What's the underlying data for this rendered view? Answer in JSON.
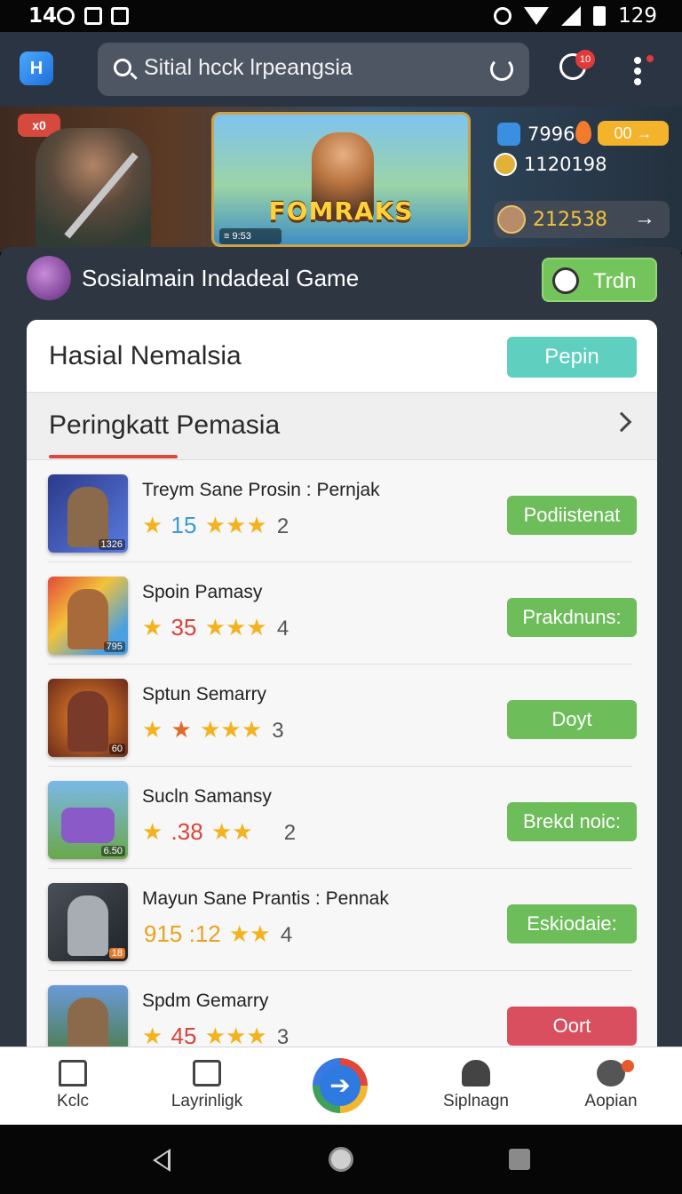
{
  "status_bar": {
    "time": "14",
    "battery_text": "129",
    "icons": [
      "message-icon",
      "notification-icon",
      "photo-icon",
      "alarm-icon",
      "wifi-icon",
      "signal-icon",
      "battery-icon"
    ]
  },
  "app_bar": {
    "logo_text": "H",
    "search_value": "Sitial hcck lrpeangsia",
    "chat_badge": "10"
  },
  "banner": {
    "badge": "x0",
    "game_title": "FOMRAKS",
    "game_subtitle": "★★★",
    "mini_label": "≡ 9:53",
    "coins": "79969",
    "coins_pill": "00 →",
    "gems": "1120198",
    "xp": "212538",
    "xp_arrow": "→"
  },
  "section": {
    "title": "Sosialmain Indadeal Game",
    "trdn_label": "Trdn"
  },
  "panel": {
    "title": "Hasial Nemalsia",
    "pepin_label": "Pepin",
    "rank_title": "Peringkatt Pemasia"
  },
  "items": [
    {
      "name": "Treym Sane Prosin : Pernjak",
      "stars_left": "★",
      "rating": "15",
      "stars_right": "★★★",
      "count": "2",
      "tag": "1326",
      "button": "Podiistenat",
      "rating_color": "#3a9bd6",
      "button_color": "green"
    },
    {
      "name": "Spoin Pamasy",
      "stars_left": "★",
      "rating": "35",
      "stars_right": "★★★",
      "count": "4",
      "tag": "795",
      "button": "Prakdnuns:",
      "rating_color": "#d8453a",
      "button_color": "green"
    },
    {
      "name": "Sptun Semarry",
      "stars_left": "★",
      "rating": "★",
      "stars_right": "★★★",
      "count": "3",
      "tag": "60",
      "button": "Doyt",
      "rating_color": "#e06a2a",
      "button_color": "green"
    },
    {
      "name": "Sucln Samansy",
      "stars_left": "★",
      "rating": ".38",
      "stars_right": "★★",
      "count": "2",
      "tag": "6.50",
      "button": "Brekd noic:",
      "rating_color": "#d8453a",
      "button_color": "green"
    },
    {
      "name": "Mayun Sane Prantis : Pennak",
      "stars_left": "",
      "rating": "915 :12",
      "stars_right": "★★",
      "count": "4",
      "tag": "18",
      "button": "Eskiodaie:",
      "rating_color": "#e8a21e",
      "button_color": "green"
    },
    {
      "name": "Spdm Gemarry",
      "stars_left": "★",
      "rating": "45",
      "stars_right": "★★★",
      "count": "3",
      "tag": "",
      "button": "Oort",
      "rating_color": "#d8453a",
      "button_color": "red"
    }
  ],
  "bottom_nav": [
    {
      "label": "Kclc",
      "icon": "home-icon"
    },
    {
      "label": "Layrinligk",
      "icon": "bag-icon"
    },
    {
      "label": "",
      "icon": "play-icon"
    },
    {
      "label": "Siplnagn",
      "icon": "community-icon"
    },
    {
      "label": "Aopian",
      "icon": "profile-icon"
    }
  ]
}
